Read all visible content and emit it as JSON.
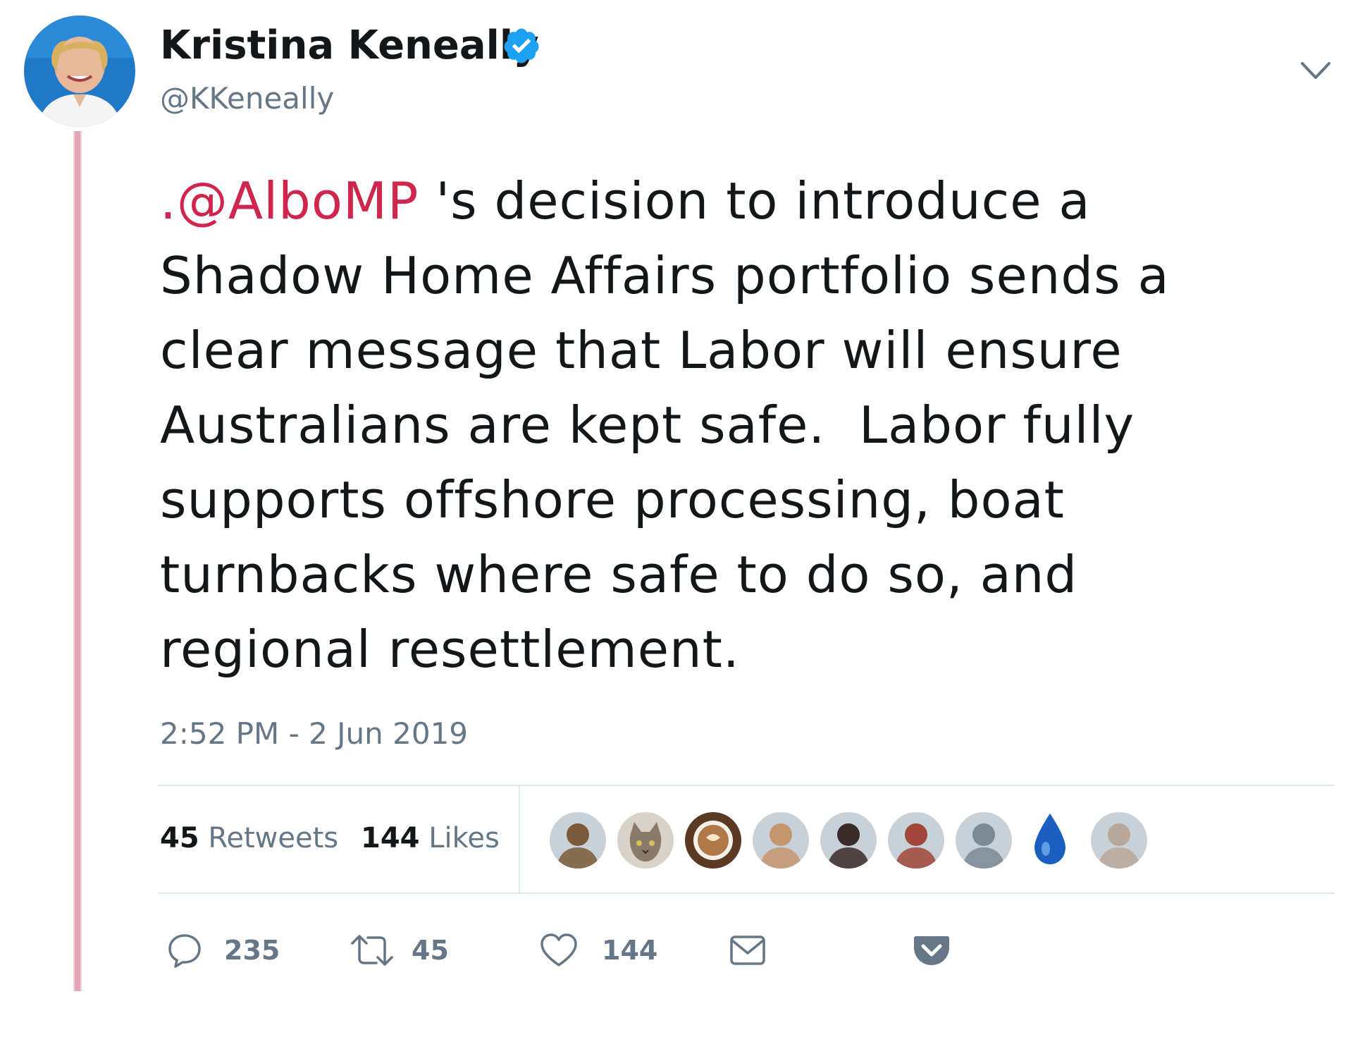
{
  "author": {
    "display_name": "Kristina Keneally",
    "handle": "@KKeneally",
    "verified": true,
    "avatar_icon": "profile-photo"
  },
  "tweet": {
    "mention": ".@AlboMP",
    "text_lines": [
      " 's decision to introduce a",
      "Shadow Home Affairs portfolio sends a",
      "clear message that Labor will ensure",
      "Australians are kept safe.  Labor fully",
      "supports offshore processing, boat",
      "turnbacks where safe to do so, and",
      "regional resettlement."
    ],
    "timestamp": "2:52 PM - 2 Jun 2019"
  },
  "stats": {
    "retweets_count": "45",
    "retweets_label": " Retweets",
    "likes_count": "144",
    "likes_label": " Likes"
  },
  "likers": [
    {
      "icon": "user-avatar",
      "color": "#7a5a3a"
    },
    {
      "icon": "cat-avatar",
      "color": "#8a7a6a"
    },
    {
      "icon": "coffee-avatar",
      "color": "#5a3a22"
    },
    {
      "icon": "user-avatar",
      "color": "#c4966e"
    },
    {
      "icon": "user-avatar",
      "color": "#3a2a2a"
    },
    {
      "icon": "user-avatar",
      "color": "#a0463a"
    },
    {
      "icon": "user-avatar",
      "color": "#7a8a96"
    },
    {
      "icon": "water-drop-avatar",
      "color": "#1a5fc0"
    },
    {
      "icon": "user-avatar",
      "color": "#b8a89a"
    }
  ],
  "actions": {
    "reply_count": "235",
    "retweet_count": "45",
    "like_count": "144"
  },
  "colors": {
    "mention": "#d0264d",
    "verified": "#1da1f2",
    "thread_line": "#e2a6b4",
    "secondary_text": "#657786"
  }
}
